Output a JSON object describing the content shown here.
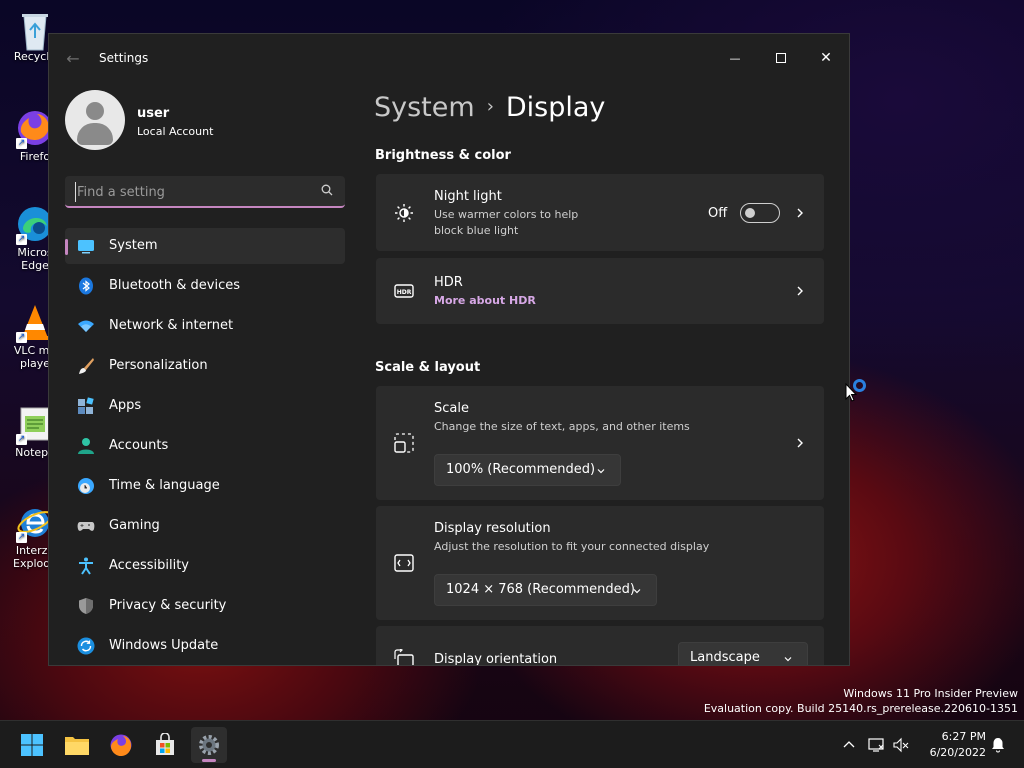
{
  "desktop": {
    "icons": [
      {
        "label": "Recycle"
      },
      {
        "label": "Firefo"
      },
      {
        "label": "Micros Edge"
      },
      {
        "label": "VLC me playe"
      },
      {
        "label": "Notepa"
      },
      {
        "label": "Interzo Explode"
      }
    ]
  },
  "window": {
    "title": "Settings",
    "back_icon": "←",
    "min_icon": "—",
    "close_icon": "✕"
  },
  "profile": {
    "name": "user",
    "account_type": "Local Account"
  },
  "search": {
    "placeholder": "Find a setting"
  },
  "nav": {
    "items": [
      {
        "label": "System",
        "icon": "system-icon",
        "active": true
      },
      {
        "label": "Bluetooth & devices",
        "icon": "bluetooth-icon"
      },
      {
        "label": "Network & internet",
        "icon": "wifi-icon"
      },
      {
        "label": "Personalization",
        "icon": "brush-icon"
      },
      {
        "label": "Apps",
        "icon": "apps-icon"
      },
      {
        "label": "Accounts",
        "icon": "accounts-icon"
      },
      {
        "label": "Time & language",
        "icon": "time-language-icon"
      },
      {
        "label": "Gaming",
        "icon": "gamepad-icon"
      },
      {
        "label": "Accessibility",
        "icon": "accessibility-icon"
      },
      {
        "label": "Privacy & security",
        "icon": "shield-icon"
      },
      {
        "label": "Windows Update",
        "icon": "update-icon"
      }
    ]
  },
  "breadcrumb": {
    "parent": "System",
    "separator": "›",
    "current": "Display"
  },
  "sections": {
    "brightness": "Brightness & color",
    "scale_layout": "Scale & layout"
  },
  "night_light": {
    "title": "Night light",
    "subtitle_line1": "Use warmer colors to help",
    "subtitle_line2": "block blue light",
    "state": "Off",
    "enabled": false
  },
  "hdr": {
    "title": "HDR",
    "link": "More about HDR"
  },
  "scale": {
    "title": "Scale",
    "subtitle": "Change the size of text, apps, and other items",
    "value": "100% (Recommended)"
  },
  "resolution": {
    "title": "Display resolution",
    "subtitle": "Adjust the resolution to fit your connected display",
    "value": "1024 × 768 (Recommended)"
  },
  "orientation": {
    "title": "Display orientation",
    "value": "Landscape"
  },
  "watermark": {
    "line1": "Windows 11 Pro Insider Preview",
    "line2": "Evaluation copy. Build 25140.rs_prerelease.220610-1351"
  },
  "taskbar": {
    "time": "6:27 PM",
    "date": "6/20/2022",
    "accent": "#c586c0"
  }
}
